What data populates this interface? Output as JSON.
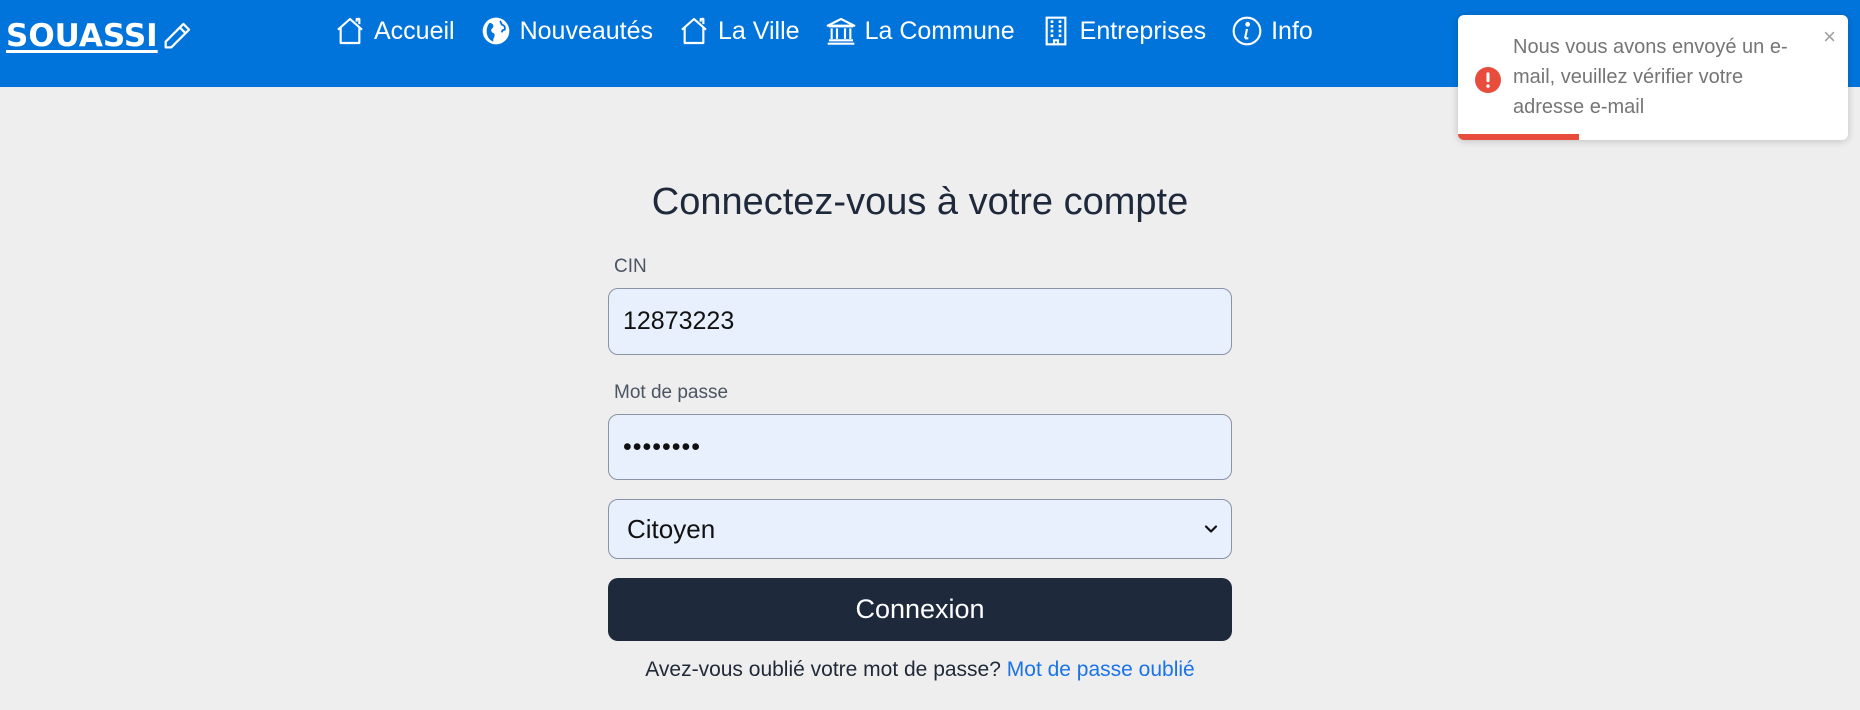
{
  "brand": {
    "name": "SOUASSI",
    "icon": "pencil-icon"
  },
  "nav": {
    "items": [
      {
        "label": "Accueil",
        "icon": "home-icon"
      },
      {
        "label": "Nouveautés",
        "icon": "globe-icon"
      },
      {
        "label": "La Ville",
        "icon": "home-icon"
      },
      {
        "label": "La Commune",
        "icon": "bank-icon"
      },
      {
        "label": "Entreprises",
        "icon": "building-icon"
      },
      {
        "label": "Info",
        "icon": "info-icon"
      }
    ]
  },
  "login": {
    "title": "Connectez-vous à votre compte",
    "cin_label": "CIN",
    "cin_value": "12873223",
    "password_label": "Mot de passe",
    "password_value": "••••••••",
    "role_selected": "Citoyen",
    "submit_label": "Connexion",
    "forgot_text": "Avez-vous oublié votre mot de passe?",
    "forgot_link": "Mot de passe oublié"
  },
  "toast": {
    "message": "Nous vous avons envoyé un e-mail, veuillez vérifier votre adresse e-mail",
    "close_symbol": "×",
    "progress": 0.31,
    "type": "error"
  },
  "colors": {
    "navbar": "#0174db",
    "button": "#1e293b",
    "link": "#1a73e8",
    "toast_progress": "#e74c3c",
    "input_bg": "#e8f0fe"
  }
}
